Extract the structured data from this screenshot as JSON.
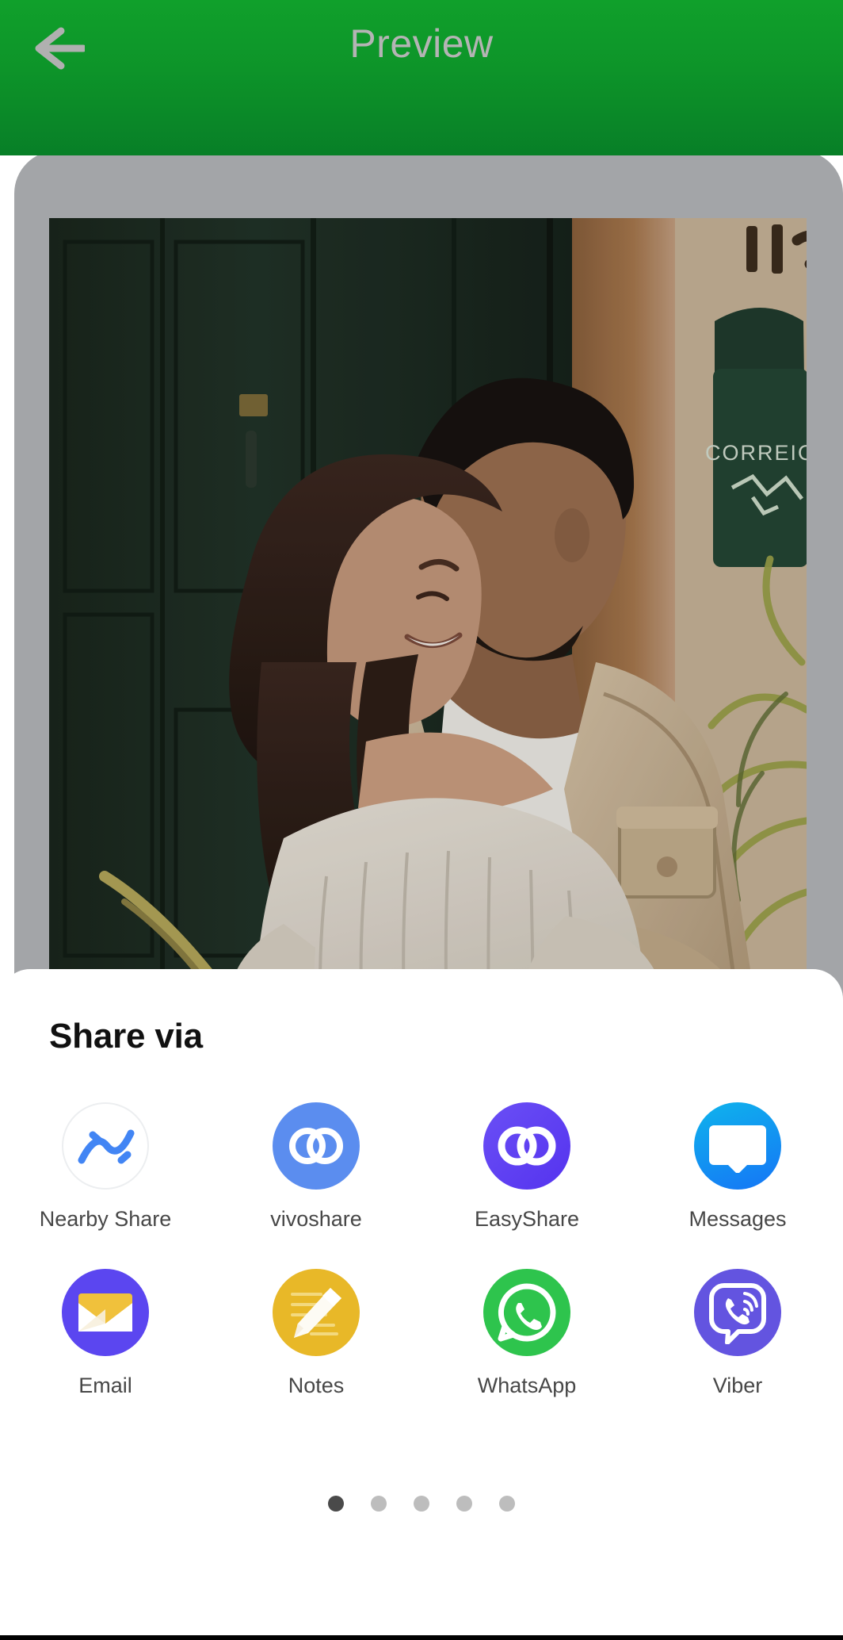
{
  "header": {
    "title": "Preview",
    "back_icon": "arrow-left-icon",
    "background_color": "#0d9429",
    "title_color": "#b4b4b4"
  },
  "preview": {
    "frame_color": "#a3a5a8",
    "photo_description": "Couple embracing in front of dark green door with CORREIO mailbox",
    "photo_text_signage": "CORREIO"
  },
  "share_sheet": {
    "title": "Share via",
    "rows": [
      [
        {
          "label": "Nearby Share",
          "icon": "nearby-share-icon",
          "bg_color": "#ffffff",
          "fg_color": "#4285f4"
        },
        {
          "label": "vivoshare",
          "icon": "vivoshare-icon",
          "bg_color": "#5b8def",
          "fg_color": "#ffffff"
        },
        {
          "label": "EasyShare",
          "icon": "easyshare-icon",
          "bg_color": "#5b46f0",
          "fg_color": "#ffffff"
        },
        {
          "label": "Messages",
          "icon": "messages-icon",
          "bg_color": "#12aee8",
          "fg_color": "#ffffff"
        }
      ],
      [
        {
          "label": "Email",
          "icon": "email-icon",
          "bg_color": "#5b46f0",
          "fg_color": "#f0c13c"
        },
        {
          "label": "Notes",
          "icon": "notes-icon",
          "bg_color": "#e8b828",
          "fg_color": "#ffffff"
        },
        {
          "label": "WhatsApp",
          "icon": "whatsapp-icon",
          "bg_color": "#2ec44d",
          "fg_color": "#ffffff"
        },
        {
          "label": "Viber",
          "icon": "viber-icon",
          "bg_color": "#6354e0",
          "fg_color": "#ffffff"
        }
      ]
    ],
    "pager": {
      "total": 5,
      "active_index": 0,
      "active_color": "#4a4a4a",
      "inactive_color": "#bdbdbd"
    }
  }
}
